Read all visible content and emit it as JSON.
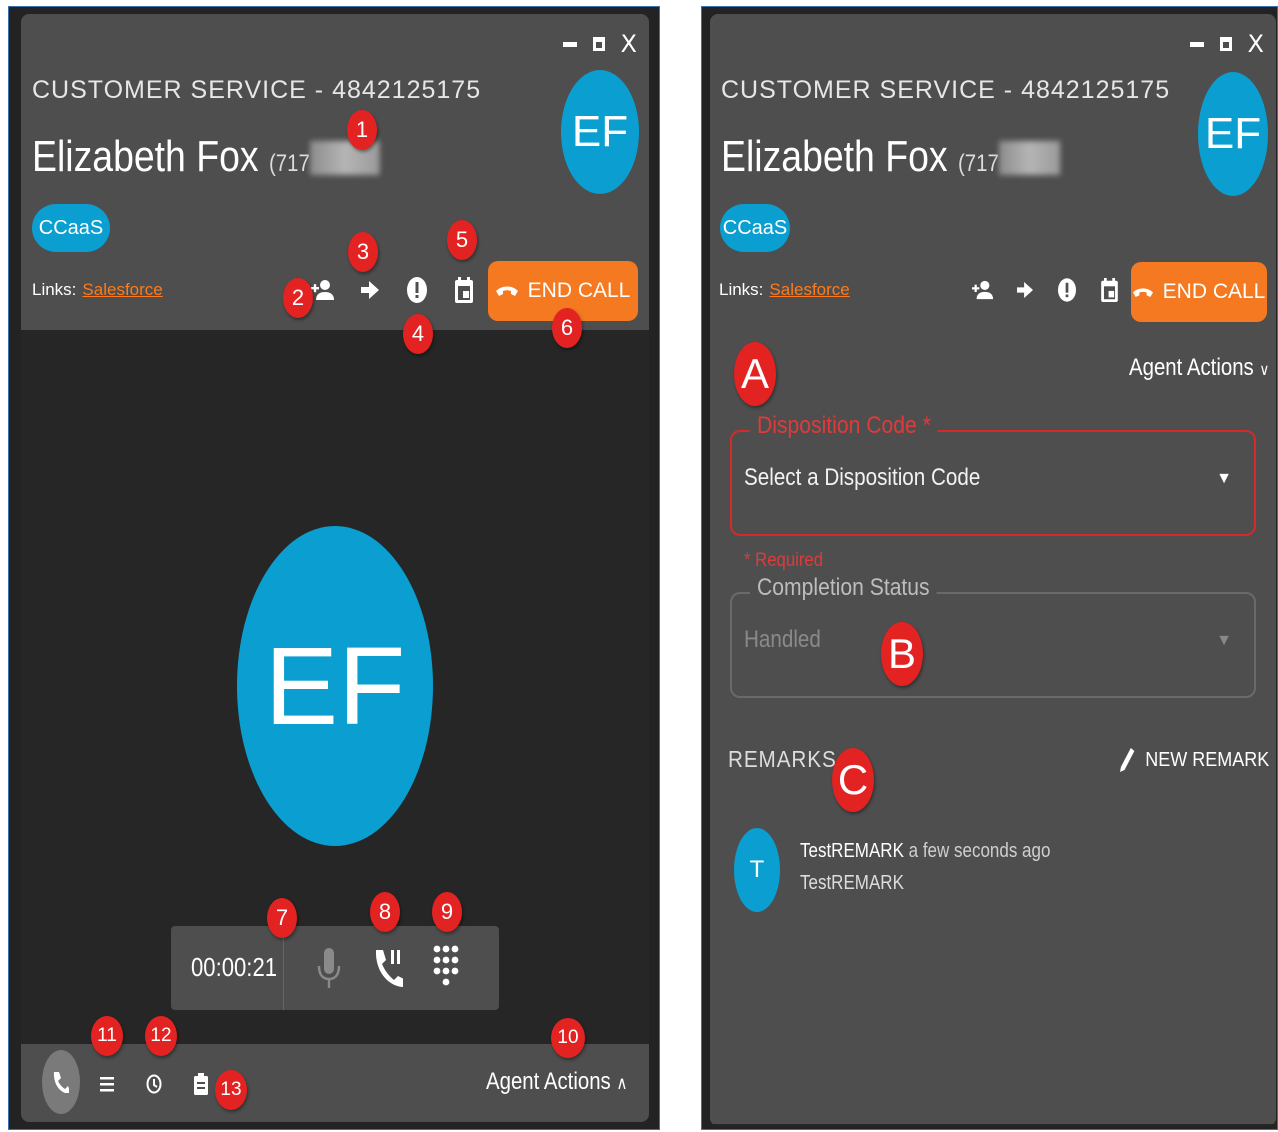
{
  "colors": {
    "accent": "#0a9fd0",
    "end_call": "#f47920",
    "annotation": "#e32222",
    "required": "#e03a3a",
    "link": "#ff7a1a"
  },
  "left": {
    "window_controls": {
      "close": "X"
    },
    "service_title": "CUSTOMER SERVICE - 4842125175",
    "caller_name": "Elizabeth Fox",
    "caller_phone_prefix": "(717",
    "avatar_initials": "EF",
    "chip": "CCaaS",
    "links_label": "Links:",
    "link_salesforce": "Salesforce",
    "end_call": "END CALL",
    "big_avatar_initials": "EF",
    "timer": "00:00:21",
    "agent_actions": "Agent Actions",
    "icons": [
      "add-contact-icon",
      "transfer-arrow-icon",
      "alert-icon",
      "calendar-icon",
      "mic-icon",
      "hold-call-icon",
      "dialpad-icon",
      "phone-icon",
      "list-icon",
      "history-icon",
      "clipboard-icon"
    ]
  },
  "right": {
    "window_controls": {
      "close": "X"
    },
    "service_title": "CUSTOMER SERVICE - 4842125175",
    "caller_name": "Elizabeth Fox",
    "caller_phone_prefix": "(717",
    "avatar_initials": "EF",
    "chip": "CCaaS",
    "links_label": "Links:",
    "link_salesforce": "Salesforce",
    "end_call": "END CALL",
    "agent_actions": "Agent Actions",
    "disposition_legend": "Disposition Code *",
    "disposition_value": "Select a Disposition Code",
    "required_note": "* Required",
    "completion_legend": "Completion Status",
    "completion_value": "Handled",
    "remarks_title": "REMARKS",
    "new_remark": "NEW REMARK",
    "remark": {
      "avatar": "T",
      "author": "TestREMARK",
      "time": "a few seconds ago",
      "text": "TestREMARK"
    }
  },
  "annotations": {
    "numbers": [
      "1",
      "2",
      "3",
      "4",
      "5",
      "6",
      "7",
      "8",
      "9",
      "10",
      "11",
      "12",
      "13"
    ],
    "letters": [
      "A",
      "B",
      "C"
    ]
  }
}
